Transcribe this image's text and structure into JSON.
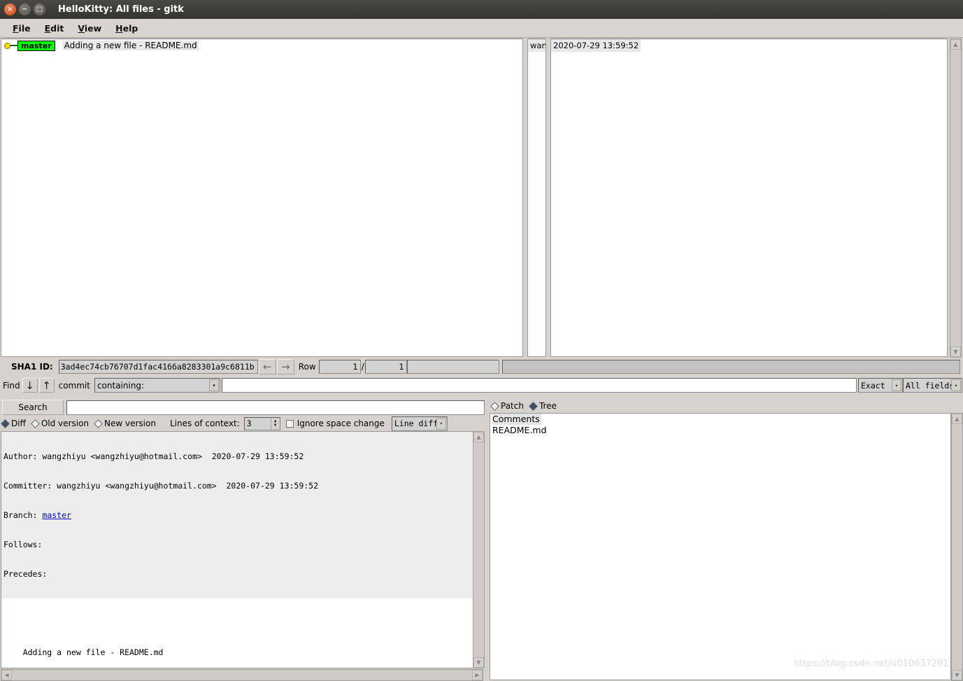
{
  "window": {
    "title": "HelloKitty: All files - gitk",
    "buttons": {
      "close": "×",
      "minimize": "−",
      "maximize": "□"
    }
  },
  "menubar": {
    "items": [
      {
        "label": "File",
        "mnemonic": "F"
      },
      {
        "label": "Edit",
        "mnemonic": "E"
      },
      {
        "label": "View",
        "mnemonic": "V"
      },
      {
        "label": "Help",
        "mnemonic": "H"
      }
    ]
  },
  "commit_list": {
    "rows": [
      {
        "ref": "master",
        "subject": "Adding a new file - README.md",
        "author": "wan",
        "date": "2020-07-29 13:59:52"
      }
    ]
  },
  "sha_row": {
    "label": "SHA1 ID:",
    "value": "3ad4ec74cb76707d1fac4166a8283301a9c6811b",
    "prev_arrow": "←",
    "next_arrow": "→",
    "row_label": "Row",
    "row_current": "1",
    "row_separator": "/",
    "row_total": "1"
  },
  "find_row": {
    "label": "Find",
    "down_arrow": "↓",
    "up_arrow": "↑",
    "commit_word": "commit",
    "containing": "containing:",
    "query": "",
    "match_mode": "Exact",
    "field_scope": "All fields",
    "chevron": "▾"
  },
  "search_row": {
    "button_label": "Search",
    "query": ""
  },
  "diff_options": {
    "diff_label": "Diff",
    "old_version_label": "Old version",
    "new_version_label": "New version",
    "selected": "Diff",
    "context_label": "Lines of context:",
    "context_value": "3",
    "ignore_space_label": "Ignore space change",
    "ignore_space_checked": false,
    "diff_mode": "Line diff",
    "chevron": "▾"
  },
  "patch_tree": {
    "patch_label": "Patch",
    "tree_label": "Tree",
    "selected": "Tree"
  },
  "commit_details": {
    "header_lines": [
      "Author: wangzhiyu <wangzhiyu@hotmail.com>  2020-07-29 13:59:52",
      "Committer: wangzhiyu <wangzhiyu@hotmail.com>  2020-07-29 13:59:52"
    ],
    "branch_label": "Branch: ",
    "branch_value": "master",
    "follows_label": "Follows:",
    "precedes_label": "Precedes:",
    "message": "    Adding a new file - README.md"
  },
  "file_list": {
    "items": [
      {
        "label": "Comments",
        "selected": true
      },
      {
        "label": "README.md",
        "selected": false
      }
    ]
  },
  "watermark": "https://blog.csdn.net/u010637291",
  "colors": {
    "titlebar": "#3d3b36",
    "close_button": "#d2491c",
    "ref_tag_bg": "#00ff00",
    "graph_node": "#ffd700",
    "graph_line": "#006400",
    "panel_bg": "#d6d2cd",
    "link": "#0000cc"
  }
}
